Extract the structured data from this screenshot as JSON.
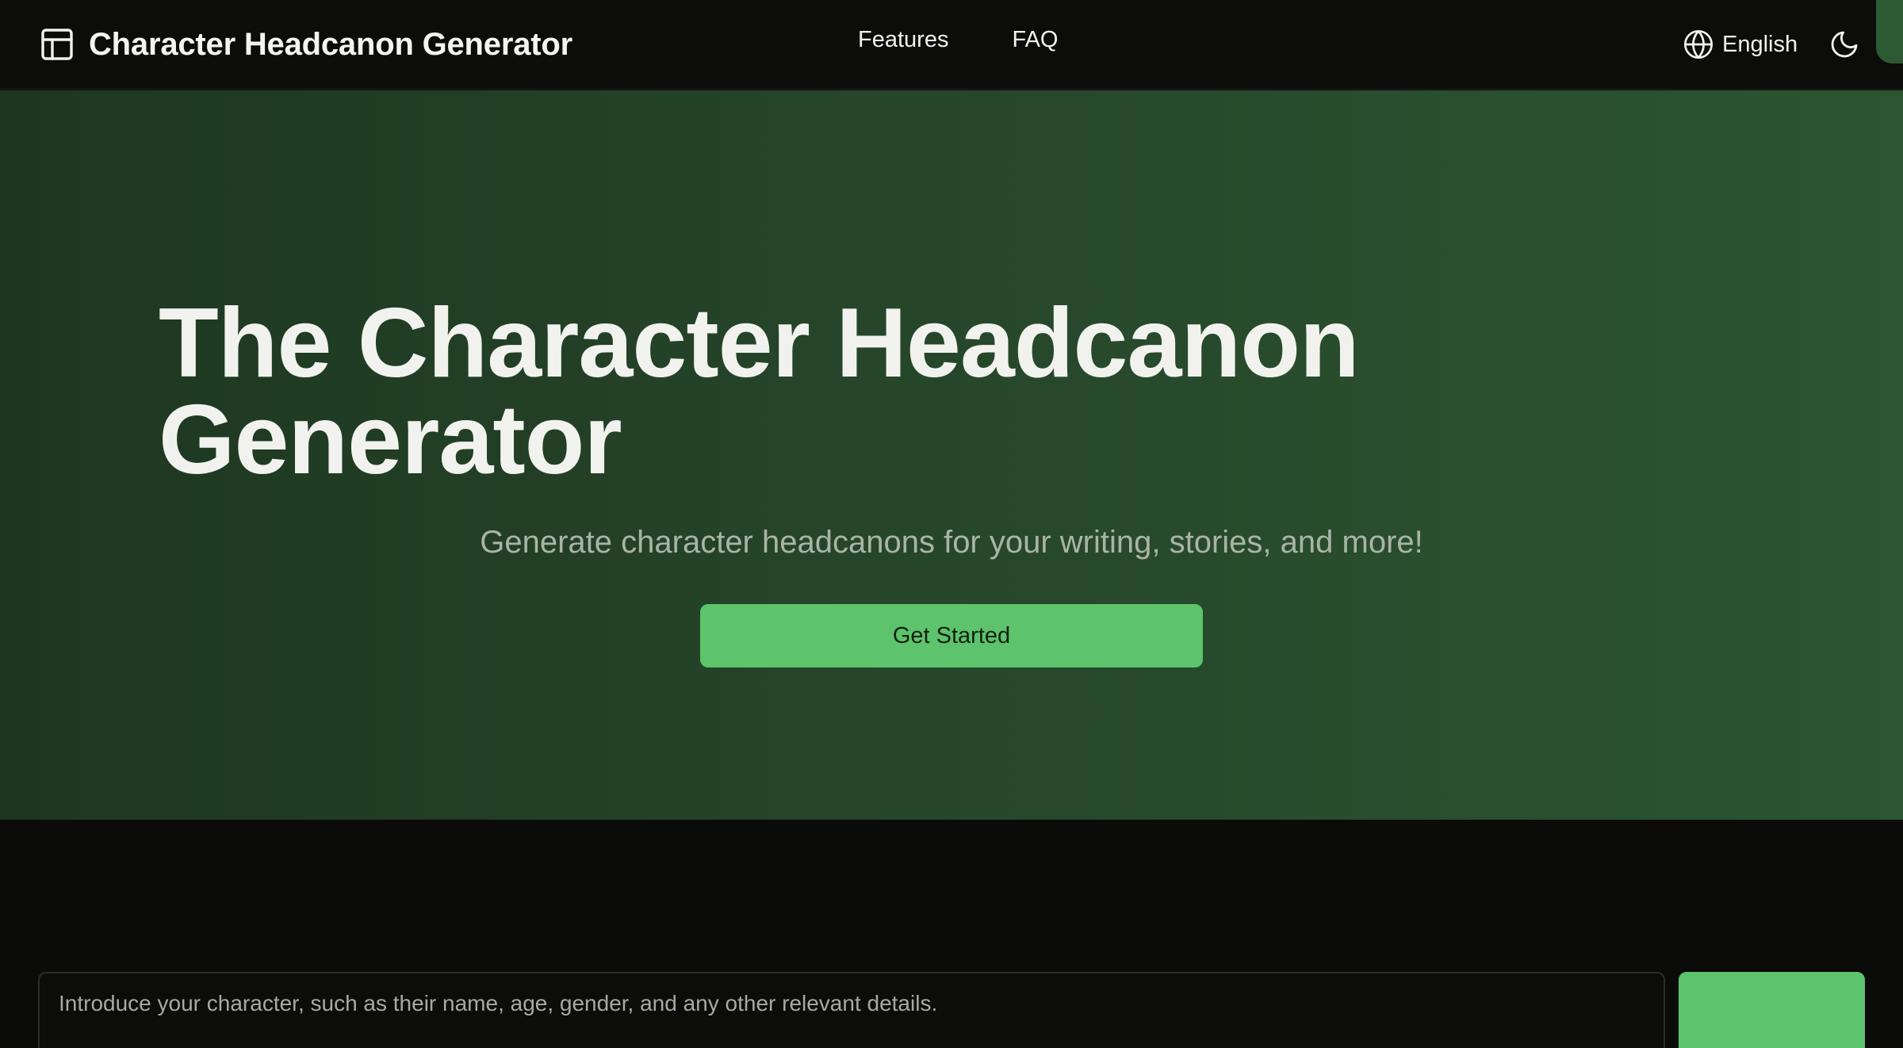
{
  "navbar": {
    "brand_icon": "layout-panel-icon",
    "brand_title": "Character Headcanon Generator",
    "links": [
      "Features",
      "FAQ"
    ],
    "language_icon": "globe-icon",
    "language": "English",
    "theme_icon": "moon-icon"
  },
  "hero": {
    "title": "The Character Headcanon Generator",
    "subtitle": "Generate character headcanons for your writing, stories, and more!",
    "cta_label": "Get Started"
  },
  "generator": {
    "input_placeholder": "Introduce your character, such as their name, age, gender, and any other relevant details.",
    "input_value": "",
    "generate_label": ""
  },
  "colors": {
    "accent": "#5dc36c",
    "page_background": "#0b0b0a",
    "hero_gradient_start": "#1d3620",
    "hero_gradient_end": "#2c5531"
  }
}
